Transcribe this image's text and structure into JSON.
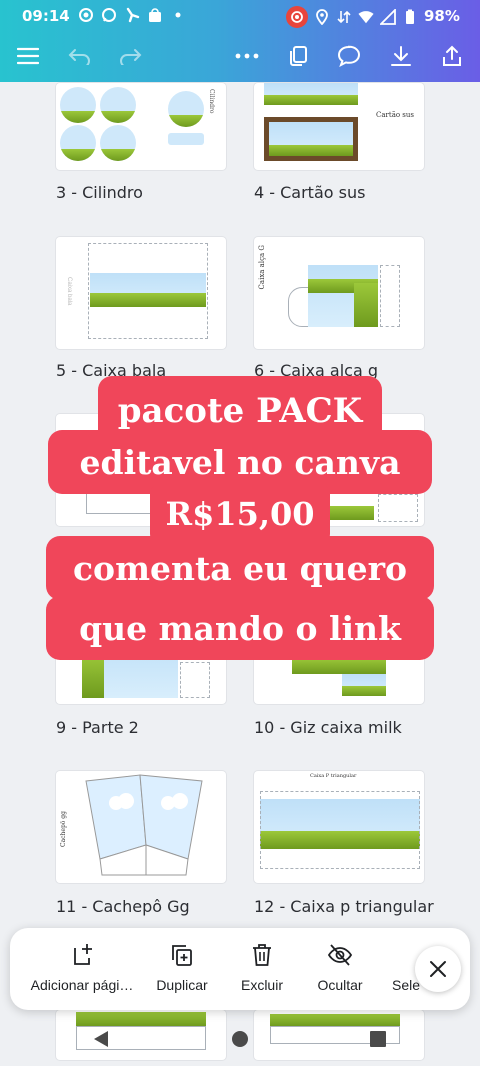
{
  "status": {
    "time": "09:14",
    "battery": "98%"
  },
  "pages": [
    {
      "caption": "3 - Cilindro",
      "art_label": "Cilindro"
    },
    {
      "caption": "4 - Cartão sus",
      "art_label": "Cartão sus"
    },
    {
      "caption": "5 - Caixa bala",
      "art_label": "Caixa bala"
    },
    {
      "caption": "6 - Caixa alça g",
      "art_label": "Caixa alça G"
    },
    {
      "caption": "9 - Parte 2"
    },
    {
      "caption": "10 - Giz caixa milk"
    },
    {
      "caption": "11 - Cachepô Gg",
      "art_label": "Cachepô gg"
    },
    {
      "caption": "12 - Caixa p triangular",
      "art_label": "Caixa P triangular"
    }
  ],
  "promo": {
    "line1": "pacote PACK",
    "line2": "editavel no canva",
    "line3": "R$15,00",
    "line4": "comenta eu quero",
    "line5": "que mando o link"
  },
  "actions": {
    "add_page": "Adicionar pági…",
    "duplicate": "Duplicar",
    "delete": "Excluir",
    "hide": "Ocultar",
    "select": "Sele"
  }
}
